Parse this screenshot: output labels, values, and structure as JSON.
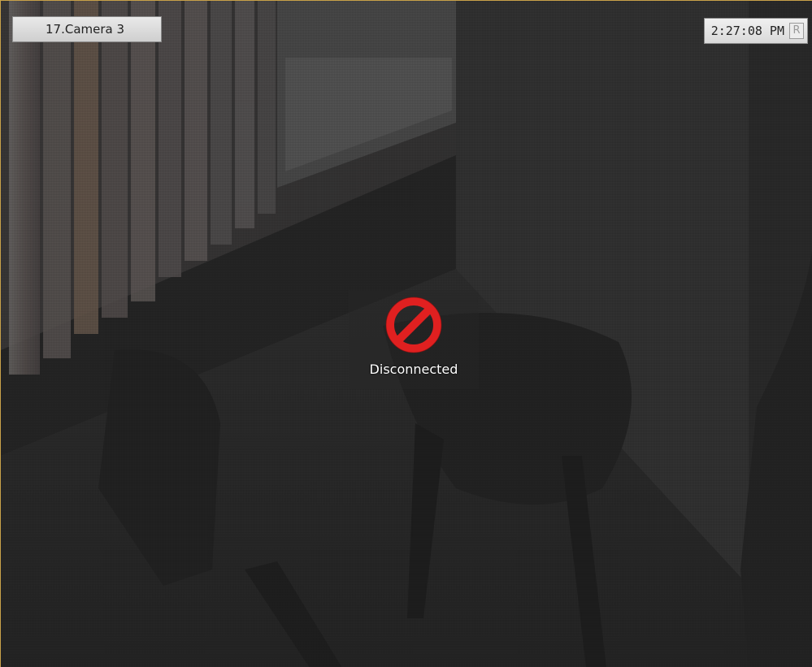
{
  "camera": {
    "name": "17.Camera 3"
  },
  "clock": {
    "time": "2:27:08 PM",
    "record_indicator": "R"
  },
  "status": {
    "text": "Disconnected",
    "icon": "prohibited-icon",
    "icon_color": "#e02020"
  },
  "colors": {
    "frame_border": "#c9a24a",
    "label_bg": "#dcdcdc"
  }
}
